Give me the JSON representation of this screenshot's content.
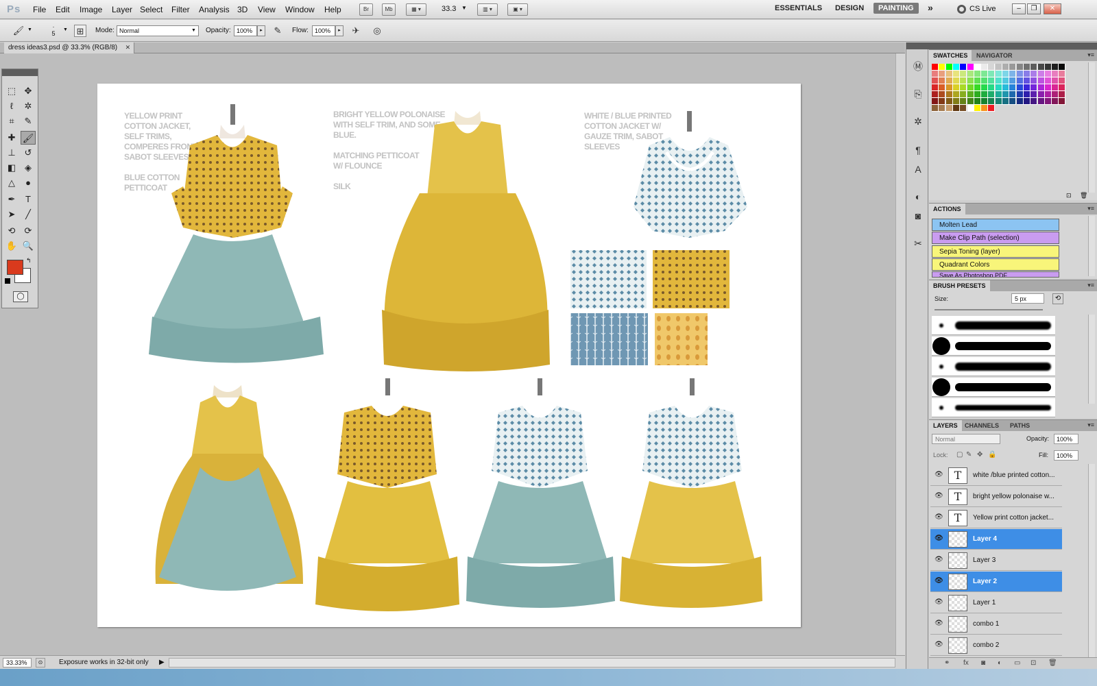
{
  "app": {
    "logo": "Ps"
  },
  "menu": [
    "File",
    "Edit",
    "Image",
    "Layer",
    "Select",
    "Filter",
    "Analysis",
    "3D",
    "View",
    "Window",
    "Help"
  ],
  "appbar": {
    "zoom": "33.3",
    "br": "Br",
    "mb": "Mb"
  },
  "workspaces": {
    "essentials": "ESSENTIALS",
    "design": "DESIGN",
    "painting": "PAINTING",
    "more": "»",
    "cs_live": "CS Live"
  },
  "options": {
    "brush_size": "5",
    "mode_label": "Mode:",
    "mode_value": "Normal",
    "opacity_label": "Opacity:",
    "opacity_value": "100%",
    "flow_label": "Flow:",
    "flow_value": "100%"
  },
  "document": {
    "tab_title": "dress ideas3.psd @ 33.3% (RGB/8)"
  },
  "artboard": {
    "notes1": [
      "YELLOW PRINT",
      "COTTON JACKET,",
      "SELF TRIMS,",
      "COMPERES FRONT,",
      "SABOT SLEEVES",
      "",
      "BLUE COTTON",
      "PETTICOAT"
    ],
    "notes2": [
      "BRIGHT YELLOW POLONAISE",
      "WITH SELF TRIM, AND SOME",
      "BLUE.",
      "",
      "MATCHING PETTICOAT",
      "W/ FLOUNCE",
      "",
      "SILK"
    ],
    "notes3": [
      "WHITE / BLUE PRINTED",
      "COTTON JACKET W/",
      "GAUZE TRIM, SABOT",
      "SLEEVES"
    ]
  },
  "status": {
    "zoom": "33.33%",
    "text": "Exposure works in 32-bit only"
  },
  "panels": {
    "swatches_tabs": [
      "SWATCHES",
      "NAVIGATOR"
    ],
    "actions_title": "ACTIONS",
    "actions": [
      {
        "label": "Molten Lead",
        "color": "#8cc4f2"
      },
      {
        "label": "Make Clip Path (selection)",
        "color": "#c99cf0"
      },
      {
        "label": "Sepia Toning (layer)",
        "color": "#f8f57a"
      },
      {
        "label": "Quadrant Colors",
        "color": "#f8f57a"
      },
      {
        "label": "Save As Photoshop PDF",
        "color": "#c99cf0"
      }
    ],
    "brush_title": "BRUSH PRESETS",
    "brush_size_label": "Size:",
    "brush_size_value": "5 px",
    "layers_tabs": [
      "LAYERS",
      "CHANNELS",
      "PATHS"
    ],
    "blend_mode": "Normal",
    "opacity_label": "Opacity:",
    "opacity_value": "100%",
    "lock_label": "Lock:",
    "fill_label": "Fill:",
    "fill_value": "100%",
    "layers": [
      {
        "name": "white /blue printed cotton...",
        "type": "text",
        "selected": false
      },
      {
        "name": "bright  yellow polonaise w...",
        "type": "text",
        "selected": false
      },
      {
        "name": "Yellow  print cotton jacket...",
        "type": "text",
        "selected": false
      },
      {
        "name": "Layer 4",
        "type": "pixel",
        "selected": true
      },
      {
        "name": "Layer 3",
        "type": "pixel",
        "selected": false
      },
      {
        "name": "Layer 2",
        "type": "pixel",
        "selected": true
      },
      {
        "name": "Layer 1",
        "type": "pixel",
        "selected": false
      },
      {
        "name": "combo 1",
        "type": "pixel",
        "selected": false
      },
      {
        "name": "combo 2",
        "type": "pixel",
        "selected": false
      }
    ]
  },
  "colors": {
    "foreground": "#d93a1d",
    "background": "#ffffff",
    "selection": "#3e8ee6",
    "teal": "#8fb8b6",
    "yellow": "#e4c24a",
    "blue_print": "#5f8fa8"
  }
}
